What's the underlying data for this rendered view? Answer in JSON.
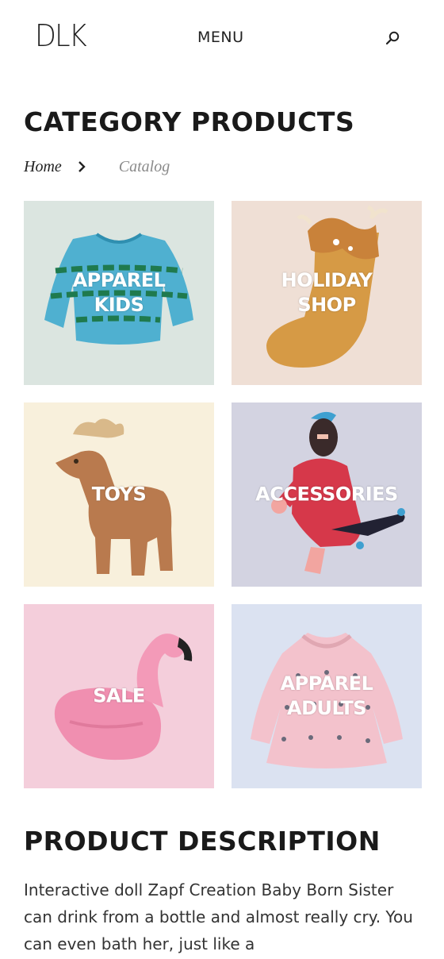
{
  "header": {
    "logo": "DLK",
    "menu_label": "MENU",
    "search_icon": "search-icon"
  },
  "page": {
    "title": "CATEGORY PRODUCTS"
  },
  "breadcrumb": {
    "items": [
      "Home",
      "Catalog"
    ],
    "separator_icon": "chevron-right-icon"
  },
  "categories": [
    {
      "label": "APPAREL\nKIDS",
      "bg": "#dbe5e0",
      "image": "blue-crocodile-sweater"
    },
    {
      "label": "HOLIDAY\nSHOP",
      "bg": "#efdfd5",
      "image": "deer-stocking"
    },
    {
      "label": "TOYS",
      "bg": "#f8f0dc",
      "image": "wooden-deer-toy"
    },
    {
      "label": "ACCESSORIES",
      "bg": "#d3d3e1",
      "image": "bigfoot-skateboard-illustration"
    },
    {
      "label": "SALE",
      "bg": "#f4cedb",
      "image": "inflatable-flamingo"
    },
    {
      "label": "APPAREL\nADULTS",
      "bg": "#dbe2f1",
      "image": "pink-rabbit-dress"
    }
  ],
  "description": {
    "title": "PRODUCT DESCRIPTION",
    "text": "Interactive doll Zapf Creation Baby Born Sister can drink from a bottle and almost really cry. You can even bath her, just like a"
  }
}
